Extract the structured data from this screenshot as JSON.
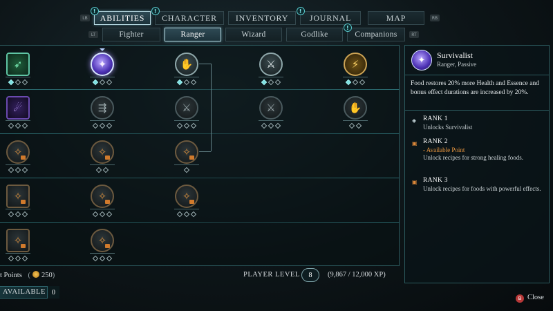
{
  "nav": {
    "left_hint": "LB",
    "right_hint": "RB",
    "tabs": [
      {
        "label": "ABILITIES",
        "alert": "!"
      },
      {
        "label": "CHARACTER",
        "alert": "!"
      },
      {
        "label": "INVENTORY",
        "alert": ""
      },
      {
        "label": "JOURNAL",
        "alert": "!"
      },
      {
        "label": "MAP",
        "alert": ""
      }
    ],
    "active_tab": "ABILITIES"
  },
  "subnav": {
    "left_hint": "LT",
    "right_hint": "RT",
    "tabs": [
      {
        "label": "Fighter",
        "alert": ""
      },
      {
        "label": "Ranger",
        "alert": ""
      },
      {
        "label": "Wizard",
        "alert": ""
      },
      {
        "label": "Godlike",
        "alert": ""
      },
      {
        "label": "Companions",
        "alert": "!"
      }
    ],
    "active_tab": "Ranger"
  },
  "grid": {
    "pip_symbol": "◇",
    "rows": [
      [
        {
          "icon": "bow-shot-icon",
          "glyph": "➶",
          "style": "teal square",
          "ranks": [
            1,
            0,
            0
          ]
        },
        {
          "icon": "survivalist-icon",
          "glyph": "✦",
          "style": "selected",
          "ranks": [
            1,
            0,
            0
          ],
          "selected": true
        },
        {
          "icon": "hand-strike-icon",
          "glyph": "✋",
          "style": "unlocked",
          "ranks": [
            1,
            0,
            0
          ]
        },
        {
          "icon": "crossed-axes-icon",
          "glyph": "⚔",
          "style": "unlocked",
          "ranks": [
            1,
            0,
            0
          ]
        },
        {
          "icon": "golden-slash-icon",
          "glyph": "⚡",
          "style": "gold",
          "ranks": [
            1,
            0,
            0
          ]
        }
      ],
      [
        {
          "icon": "purple-runner-icon",
          "glyph": "☄",
          "style": "purple square",
          "ranks": [
            0,
            0,
            0
          ]
        },
        {
          "icon": "arrow-volley-icon",
          "glyph": "⇶",
          "style": "",
          "ranks": [
            0,
            0,
            0
          ]
        },
        {
          "icon": "daggers-icon",
          "glyph": "⚔",
          "style": "",
          "ranks": [
            0,
            0,
            0
          ]
        },
        {
          "icon": "crossed-swords-icon",
          "glyph": "⚔",
          "style": "",
          "ranks": [
            0,
            0,
            0
          ]
        },
        {
          "icon": "claw-icon",
          "glyph": "✋",
          "style": "",
          "ranks": [
            0,
            0
          ]
        }
      ],
      [
        {
          "icon": "locked-ability-icon",
          "glyph": "✧",
          "style": "locked",
          "ranks": [
            0,
            0,
            0
          ]
        },
        {
          "icon": "locked-ability-icon",
          "glyph": "✧",
          "style": "locked",
          "ranks": [
            0,
            0
          ]
        },
        {
          "icon": "locked-ability-icon",
          "glyph": "✧",
          "style": "locked",
          "ranks": [
            0
          ]
        }
      ],
      [
        {
          "icon": "locked-ability-icon",
          "glyph": "✧",
          "style": "locked square",
          "ranks": [
            0,
            0,
            0
          ]
        },
        {
          "icon": "locked-ability-icon",
          "glyph": "✧",
          "style": "locked",
          "ranks": [
            0,
            0,
            0
          ]
        },
        {
          "icon": "locked-ability-icon",
          "glyph": "✧",
          "style": "locked",
          "ranks": [
            0,
            0,
            0
          ]
        }
      ],
      [
        {
          "icon": "locked-ability-icon",
          "glyph": "✧",
          "style": "locked square",
          "ranks": [
            0,
            0,
            0
          ]
        },
        {
          "icon": "locked-ability-icon",
          "glyph": "✧",
          "style": "locked",
          "ranks": [
            0,
            0,
            0
          ]
        }
      ]
    ]
  },
  "detail": {
    "icon": "survivalist-icon",
    "title": "Survivalist",
    "subtitle": "Ranger, Passive",
    "description": "Food restores 20% more Health and Essence and bonus effect durations are increased by 20%.",
    "ranks": [
      {
        "marker": "◈",
        "marker_color": "#cfe0e4",
        "title": "RANK 1",
        "lines": [
          {
            "text": "Unlocks Survivalist",
            "orange": false
          }
        ]
      },
      {
        "marker": "▣",
        "marker_color": "#e08a3a",
        "title": "RANK 2",
        "lines": [
          {
            "text": "- Available Point",
            "orange": true
          },
          {
            "text": "Unlock recipes for strong healing foods.",
            "orange": false
          }
        ]
      },
      {
        "marker": "▣",
        "marker_color": "#e08a3a",
        "title": "RANK 3",
        "lines": [
          {
            "text": "Unlock recipes for foods with powerful effects.",
            "orange": false
          }
        ]
      }
    ]
  },
  "footer": {
    "points_label": "t Points",
    "points_value": "250",
    "player_level_label": "PLAYER LEVEL",
    "player_level": "8",
    "xp": "(9,867 / 12,000 XP)",
    "available_label": "AVAILABLE",
    "available_count": "0",
    "close_hint": "B",
    "close_label": "Close"
  }
}
